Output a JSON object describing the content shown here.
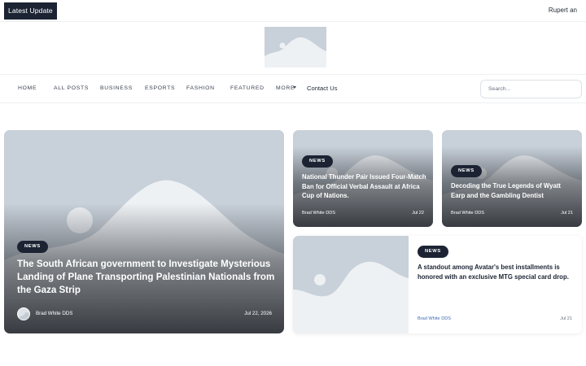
{
  "topbar": {
    "latest_label": "Latest Update",
    "user_name": "Rupert an"
  },
  "nav": {
    "items": [
      "HOME",
      "ALL POSTS",
      "BUSINESS",
      "ESPORTS",
      "FASHION",
      "FEATURED",
      "MORE"
    ],
    "contact_label": "Contact Us",
    "search_placeholder": "Search..."
  },
  "posts": [
    {
      "category": "NEWS",
      "title": "The South African government to Investigate Mysterious Landing of Plane Transporting Palestinian Nationals from the Gaza Strip",
      "author": "Brad White DDS",
      "date": "Jul 22, 2026"
    },
    {
      "category": "NEWS",
      "title": "National Thunder Pair Issued Four-Match Ban for Official Verbal Assault at Africa Cup of Nations.",
      "author": "Brad White DDS",
      "date": "Jul 22"
    },
    {
      "category": "NEWS",
      "title": "Decoding the True Legends of Wyatt Earp and the Gambling Dentist",
      "author": "Brad White DDS",
      "date": "Jul 21"
    },
    {
      "category": "NEWS",
      "title": "A standout among Avatar's best installments is honored with an exclusive MTG special card drop.",
      "author": "Brad White DDS",
      "date": "Jul 21"
    }
  ],
  "colors": {
    "dark": "#1c2434",
    "placeholder": "#c8d0d9",
    "author_link": "#3d6bb3"
  }
}
